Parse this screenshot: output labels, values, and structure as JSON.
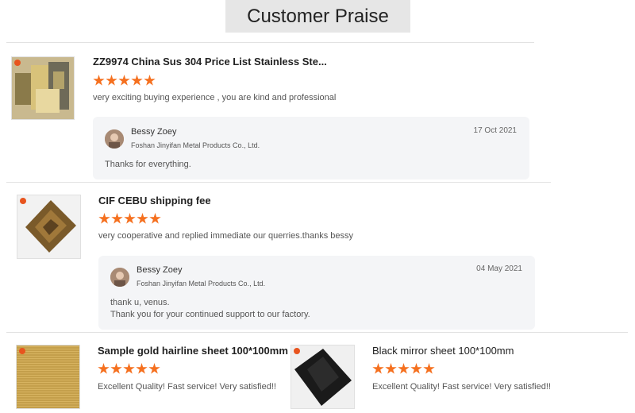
{
  "page_title": "Customer Praise",
  "accent_color": "#f5701f",
  "reviews": [
    {
      "product": "ZZ9974 China Sus 304 Price List Stainless Ste...",
      "rating": 5,
      "comment": "very exciting buying experience , you are kind and professional",
      "reply": {
        "name": "Bessy Zoey",
        "company": "Foshan Jinyifan Metal Products Co., Ltd.",
        "date": "17 Oct 2021",
        "lines": [
          "Thanks for everything."
        ]
      }
    },
    {
      "product": "CIF CEBU shipping fee",
      "rating": 5,
      "comment": "very cooperative and replied immediate our querries.thanks bessy",
      "reply": {
        "name": "Bessy Zoey",
        "company": "Foshan Jinyifan Metal Products Co., Ltd.",
        "date": "04 May 2021",
        "lines": [
          "thank u, venus.",
          "Thank you for your continued support to our factory."
        ]
      }
    },
    {
      "product": "Sample gold hairline sheet 100*100mm",
      "rating": 5,
      "comment": "Excellent Quality! Fast service! Very satisfied!!"
    },
    {
      "product": "Black mirror sheet 100*100mm",
      "rating": 5,
      "comment": "Excellent Quality! Fast service! Very satisfied!!"
    }
  ]
}
